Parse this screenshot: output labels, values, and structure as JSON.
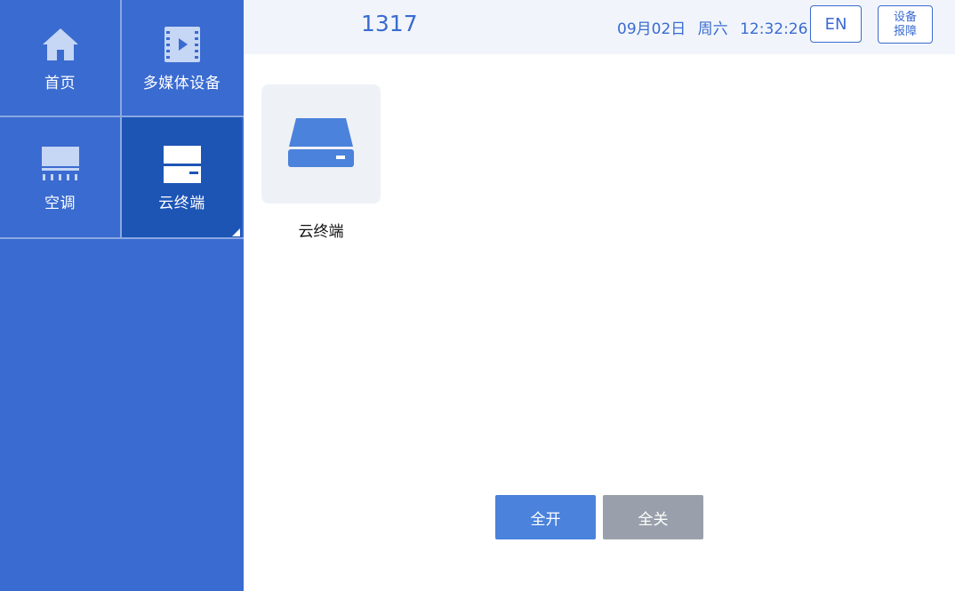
{
  "sidebar": {
    "items": [
      {
        "label": "首页",
        "icon": "home-icon"
      },
      {
        "label": "多媒体设备",
        "icon": "media-player-icon"
      },
      {
        "label": "空调",
        "icon": "air-conditioner-icon"
      },
      {
        "label": "云终端",
        "icon": "cloud-terminal-icon",
        "selected": true
      }
    ]
  },
  "header": {
    "room_number": "1317",
    "date": "09月02日",
    "weekday": "周六",
    "time": "12:32:26",
    "lang_button": "EN",
    "report_line1": "设备",
    "report_line2": "报障"
  },
  "main": {
    "devices": [
      {
        "label": "云终端",
        "icon": "cloud-terminal-icon"
      }
    ]
  },
  "actions": {
    "all_on": "全开",
    "all_off": "全关"
  },
  "colors": {
    "sidebar_bg": "#3a6bd0",
    "sidebar_selected": "#1d55b5",
    "accent": "#3a6bd0",
    "all_on_bg": "#4a82dc",
    "all_off_bg": "#9aa0ab",
    "header_bg": "#f1f5fb"
  }
}
